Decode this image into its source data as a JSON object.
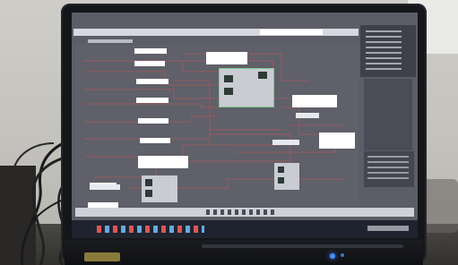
{
  "colors": {
    "wall": "#c8c6c0",
    "wall_shadow": "#8e8c86",
    "desk": "#3f3d3a",
    "bezel": "#151619",
    "bezel_edge": "#2a2b30",
    "screen": "#5c5d66",
    "editor_bg": "#5f6069",
    "titlebar": "#d7d8df",
    "right_panel": "#3e404a",
    "wire": "#8a5c64",
    "label": "#eceef2",
    "node_face": "#c9ccd2",
    "node_dark": "#2d3a36",
    "node_selected_border": "#7bd08f",
    "taskbar": "#1f2330",
    "bottom_bar": "#cfd1d8",
    "led": "#4a8cff",
    "cable": "#1a1a1c"
  }
}
